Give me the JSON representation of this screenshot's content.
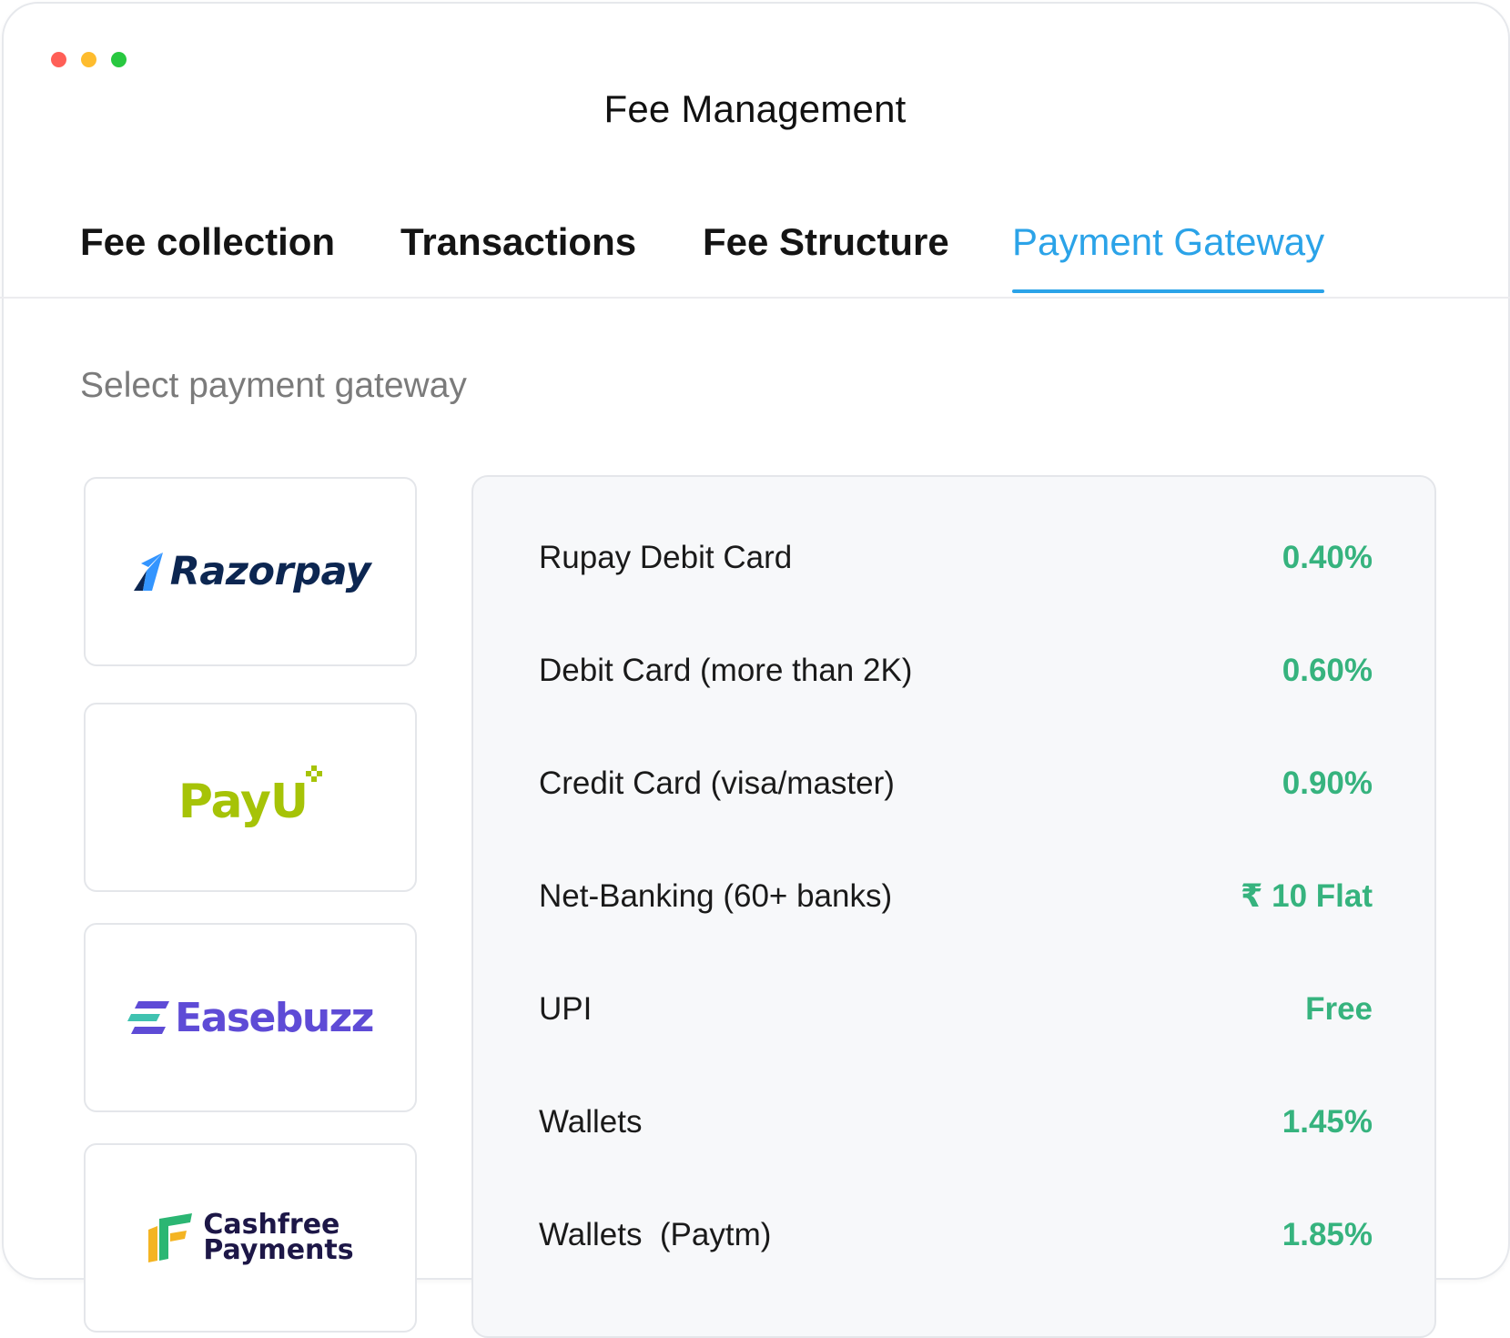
{
  "window": {
    "title": "Fee Management",
    "controls": {
      "close_color": "#ff5f57",
      "minimize_color": "#febc2e",
      "zoom_color": "#28c840"
    }
  },
  "tabs": [
    {
      "label": "Fee collection",
      "active": false
    },
    {
      "label": "Transactions",
      "active": false
    },
    {
      "label": "Fee Structure",
      "active": false
    },
    {
      "label": "Payment Gateway",
      "active": true
    }
  ],
  "accent_color": "#2ba3e8",
  "section": {
    "label": "Select payment gateway"
  },
  "gateways": [
    {
      "name": "Razorpay",
      "logo_icon": "razorpay-logo-icon",
      "brand_color": "#0c2651"
    },
    {
      "name": "PayU",
      "logo_icon": "payu-logo-icon",
      "brand_color": "#a6c307"
    },
    {
      "name": "Easebuzz",
      "logo_icon": "easebuzz-logo-icon",
      "brand_color": "#5e4bd6"
    },
    {
      "name": "Cashfree Payments",
      "name_line1": "Cashfree",
      "name_line2": "Payments",
      "logo_icon": "cashfree-logo-icon",
      "brand_color": "#1d1747"
    }
  ],
  "rates": {
    "value_color": "#36b37e",
    "rows": [
      {
        "label": "Rupay Debit Card",
        "value": "0.40%"
      },
      {
        "label": "Debit Card (more than 2K)",
        "value": "0.60%"
      },
      {
        "label": "Credit Card (visa/master)",
        "value": "0.90%"
      },
      {
        "label": "Net-Banking (60+ banks)",
        "value": "₹ 10 Flat"
      },
      {
        "label": "UPI",
        "value": "Free"
      },
      {
        "label": "Wallets",
        "value": "1.45%"
      },
      {
        "label": "Wallets  (Paytm)",
        "value": "1.85%"
      }
    ]
  }
}
